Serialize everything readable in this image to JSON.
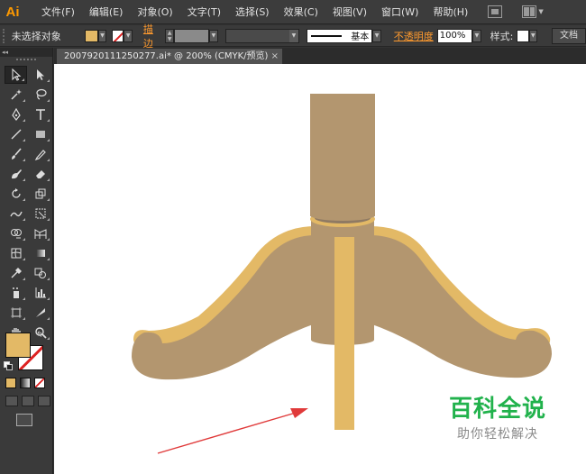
{
  "app": {
    "logo": "Ai"
  },
  "menu": {
    "items": [
      "文件(F)",
      "编辑(E)",
      "对象(O)",
      "文字(T)",
      "选择(S)",
      "效果(C)",
      "视图(V)",
      "窗口(W)",
      "帮助(H)"
    ],
    "icons": [
      "bridge-icon",
      "arrange-documents-icon"
    ]
  },
  "control_bar": {
    "selection_label": "未选择对象",
    "fill_color": "#e3b966",
    "stroke_label": "描边",
    "profile_label": "基本",
    "opacity_label": "不透明度",
    "opacity_value": "100%",
    "style_label": "样式:",
    "document_setup_label": "文档"
  },
  "document": {
    "tab_title": "2007920111250277.ai* @ 200% (CMYK/预览)",
    "close_glyph": "×"
  },
  "tools_panel": {
    "collapse_glyph": "◂◂",
    "fill_color": "#e3b966",
    "stroke_color": "#ffffff"
  },
  "artwork": {
    "colors": {
      "wood": "#b3966f",
      "wood_dark": "#8f7a63",
      "highlight": "#e3b966",
      "arrow": "#e03a3a"
    }
  },
  "watermark": {
    "title": "百科全说",
    "subtitle": "助你轻松解决"
  }
}
